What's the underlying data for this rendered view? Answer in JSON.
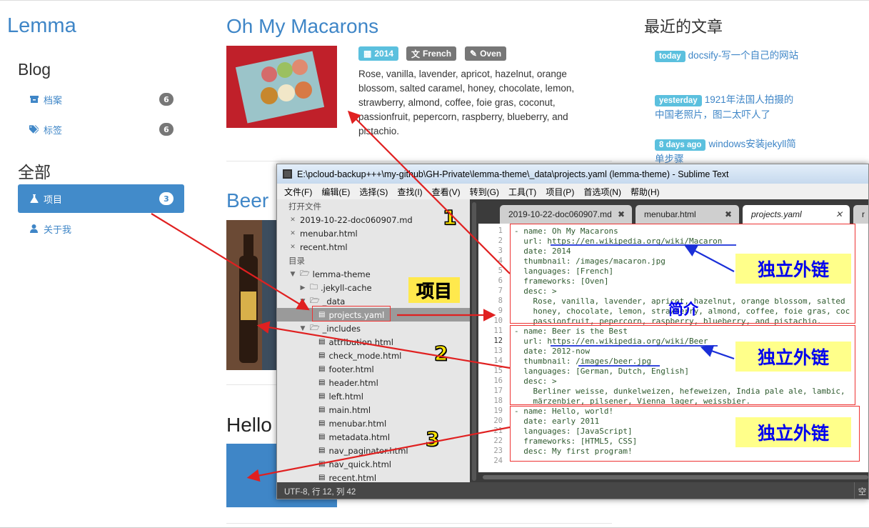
{
  "site": {
    "brand": "Lemma"
  },
  "left": {
    "blog_heading": "Blog",
    "blog_items": [
      {
        "label": "档案",
        "count": "6",
        "icon": "archive-icon"
      },
      {
        "label": "标签",
        "count": "6",
        "icon": "tags-icon"
      }
    ],
    "all_heading": "全部",
    "all_items": [
      {
        "label": "项目",
        "count": "3",
        "icon": "flask-icon"
      },
      {
        "label": "关于我",
        "icon": "user-icon"
      }
    ]
  },
  "posts": [
    {
      "title": "Oh My Macarons",
      "badges": [
        "2014",
        "French",
        "Oven"
      ],
      "desc": "Rose, vanilla, lavender, apricot, hazelnut, orange blossom, salted caramel, honey, chocolate, lemon, strawberry, almond, coffee, foie gras, coconut, passionfruit, pepercorn, raspberry, blueberry, and pistachio."
    },
    {
      "title": "Beer"
    },
    {
      "title": "Hello"
    }
  ],
  "recent": {
    "heading": "最近的文章",
    "items": [
      {
        "tag": "today",
        "title": "docsify-写一个自己的网站"
      },
      {
        "tag": "yesterday",
        "title": "1921年法国人拍摄的中国老照片，图二太吓人了"
      },
      {
        "tag": "8 days ago",
        "title": "windows安装jekyll简单步骤"
      }
    ]
  },
  "sublime": {
    "title": "E:\\pcloud-backup+++\\my-github\\GH-Private\\lemma-theme\\_data\\projects.yaml (lemma-theme) - Sublime Text",
    "menu": [
      "文件(F)",
      "编辑(E)",
      "选择(S)",
      "查找(I)",
      "查看(V)",
      "转到(G)",
      "工具(T)",
      "项目(P)",
      "首选项(N)",
      "帮助(H)"
    ],
    "open_files_label": "打开文件",
    "open_files": [
      "2019-10-22-doc060907.md",
      "menubar.html",
      "recent.html"
    ],
    "folders_label": "目录",
    "tree": [
      {
        "label": "lemma-theme",
        "kind": "folder-open",
        "depth": 0
      },
      {
        "label": ".jekyll-cache",
        "kind": "folder",
        "depth": 1
      },
      {
        "label": "_data",
        "kind": "folder-open",
        "depth": 1
      },
      {
        "label": "projects.yaml",
        "kind": "file",
        "depth": 2,
        "selected": true
      },
      {
        "label": "_includes",
        "kind": "folder-open",
        "depth": 1
      },
      {
        "label": "attribution.html",
        "kind": "file",
        "depth": 2
      },
      {
        "label": "check_mode.html",
        "kind": "file",
        "depth": 2
      },
      {
        "label": "footer.html",
        "kind": "file",
        "depth": 2
      },
      {
        "label": "header.html",
        "kind": "file",
        "depth": 2
      },
      {
        "label": "left.html",
        "kind": "file",
        "depth": 2
      },
      {
        "label": "main.html",
        "kind": "file",
        "depth": 2
      },
      {
        "label": "menubar.html",
        "kind": "file",
        "depth": 2
      },
      {
        "label": "metadata.html",
        "kind": "file",
        "depth": 2
      },
      {
        "label": "nav_paginator.html",
        "kind": "file",
        "depth": 2
      },
      {
        "label": "nav_quick.html",
        "kind": "file",
        "depth": 2
      },
      {
        "label": "recent.html",
        "kind": "file",
        "depth": 2
      }
    ],
    "tabs": [
      "2019-10-22-doc060907.md",
      "menubar.html",
      "projects.yaml",
      "r"
    ],
    "code": [
      "- name: Oh My Macarons",
      "  url: https://en.wikipedia.org/wiki/Macaron",
      "  date: 2014",
      "  thumbnail: /images/macaron.jpg",
      "  languages: [French]",
      "  frameworks: [Oven]",
      "  desc: >",
      "    Rose, vanilla, lavender, apricot, hazelnut, orange blossom, salted",
      "    honey, chocolate, lemon, strawberry, almond, coffee, foie gras, coc",
      "    passionfruit, pepercorn, raspberry, blueberry, and pistachio.",
      "- name: Beer is the Best",
      "  url: https://en.wikipedia.org/wiki/Beer",
      "  date: 2012-now",
      "  thumbnail: /images/beer.jpg",
      "  languages: [German, Dutch, English]",
      "  desc: >",
      "    Berliner weisse, dunkelweizen, hefeweizen, India pale ale, lambic,",
      "    märzenbier, pilsener, Vienna lager, weissbier.",
      "- name: Hello, world!",
      "  date: early 2011",
      "  languages: [JavaScript]",
      "  frameworks: [HTML5, CSS]",
      "  desc: My first program!",
      ""
    ],
    "status": "UTF-8, 行 12, 列 42",
    "status_right": "空"
  },
  "annotations": {
    "project_label": "项目",
    "intro_label": "简介",
    "external_link_label": "独立外链",
    "numbers": [
      "1",
      "2",
      "3"
    ]
  },
  "colors": {
    "link": "#3f86c7",
    "active": "#428bca",
    "badge_blue": "#5bc0de",
    "badge_gray": "#777777",
    "annotation_red": "#e02020",
    "annotation_yellow": "#ffff8a"
  }
}
